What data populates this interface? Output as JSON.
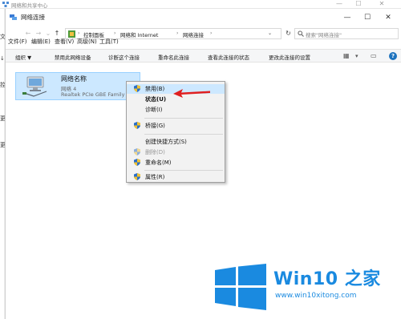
{
  "background_window": {
    "title": "网络和共享中心",
    "left_letters": [
      "文",
      "↓",
      "控",
      "更",
      "更"
    ]
  },
  "window": {
    "title": "网络连接",
    "min_glyph": "—",
    "max_glyph": "☐",
    "close_glyph": "✕",
    "expand_glyph": "⌄"
  },
  "address_bar": {
    "back_glyph": "←",
    "forward_glyph": "→",
    "up_glyph": "↑",
    "crumbs": [
      "控制面板",
      "网络和 Internet",
      "网络连接"
    ],
    "separator": "›",
    "dropdown_glyph": "⌄",
    "refresh_glyph": "↻",
    "search_placeholder": "搜索\"网络连接\""
  },
  "menubar": [
    "文件(F)",
    "编辑(E)",
    "查看(V)",
    "高级(N)",
    "工具(T)"
  ],
  "command_bar": {
    "items": [
      "组织 ▼",
      "禁用此网络设备",
      "诊断这个连接",
      "重命名此连接",
      "查看此连接的状态",
      "更改此连接的设置"
    ],
    "view_glyph": "▦",
    "view_dd": "▾",
    "pane_glyph": "▭",
    "help_glyph": "?"
  },
  "network_item": {
    "name": "网络名称",
    "status": "网络  4",
    "adapter": "Realtek PCIe GBE Family"
  },
  "context_menu": {
    "items": [
      {
        "label": "禁用(B)",
        "shield": true,
        "bold": false,
        "disabled": false,
        "highlighted": true
      },
      {
        "label": "状态(U)",
        "shield": false,
        "bold": true,
        "disabled": false
      },
      {
        "label": "诊断(I)",
        "shield": false,
        "bold": false,
        "disabled": false
      },
      {
        "label": "桥接(G)",
        "shield": true,
        "bold": false,
        "disabled": false
      },
      {
        "label": "创建快捷方式(S)",
        "shield": false,
        "bold": false,
        "disabled": false
      },
      {
        "label": "删除(D)",
        "shield": true,
        "bold": false,
        "disabled": true
      },
      {
        "label": "重命名(M)",
        "shield": true,
        "bold": false,
        "disabled": false
      },
      {
        "label": "属性(R)",
        "shield": true,
        "bold": false,
        "disabled": false
      }
    ]
  },
  "watermark": {
    "brand": "Win10 之家",
    "url": "www.win10xitong.com"
  },
  "colors": {
    "accent": "#1a8ae0",
    "selection": "#cce8ff",
    "arrow": "#e02020"
  }
}
